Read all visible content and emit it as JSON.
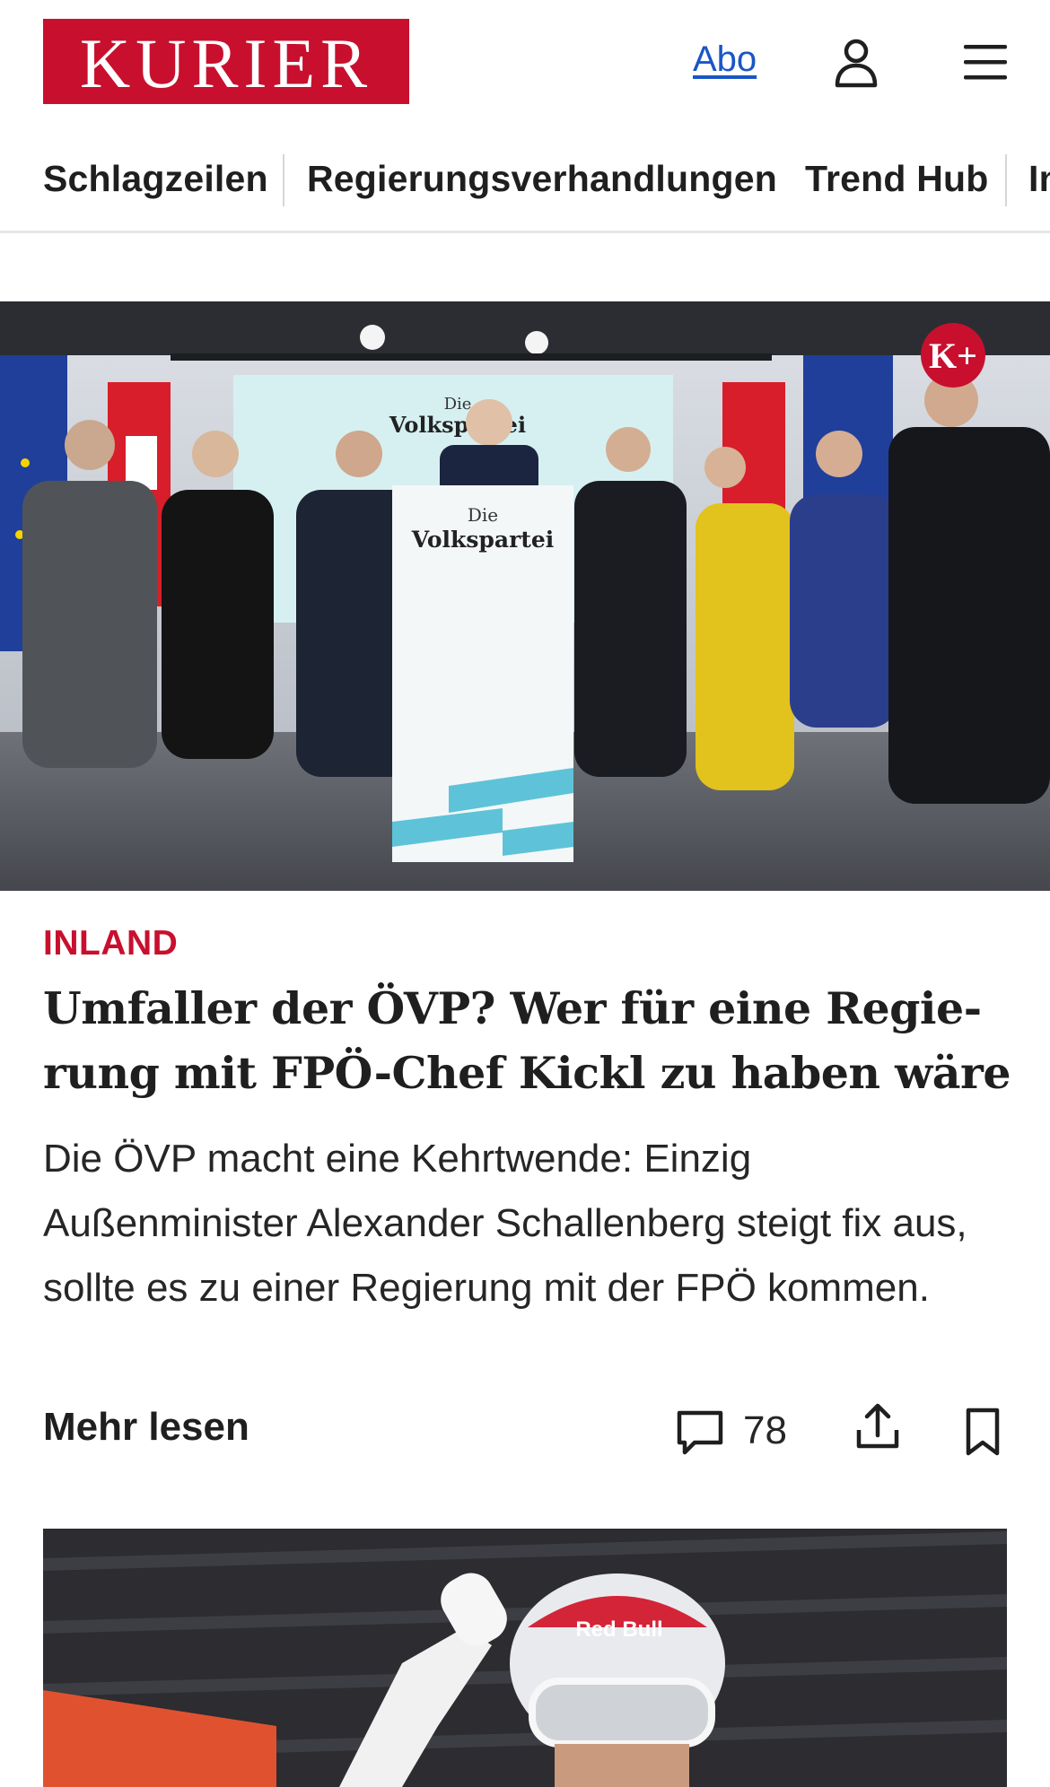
{
  "header": {
    "logo_text": "KURIER",
    "abo_label": "Abo",
    "icons": [
      "user-icon",
      "menu-icon"
    ]
  },
  "nav": {
    "items": [
      {
        "label": "Schlagzeilen"
      },
      {
        "label": "Regierungsverhandlungen"
      },
      {
        "label": "Trend Hub"
      },
      {
        "label": "In"
      }
    ]
  },
  "hero": {
    "podium_text_top": "Die",
    "podium_text_bottom": "Volkspartei",
    "screen_text_top": "Die",
    "screen_text_bottom": "Volkspartei",
    "badge": "K+"
  },
  "article": {
    "category": "INLAND",
    "headline_line1": "Umfaller der ÖVP? Wer für eine Regie-",
    "headline_line2": "rung mit FPÖ-Chef Kickl zu haben wäre",
    "teaser": "Die ÖVP macht eine Kehrtwende: Einzig Außenminister Alexander Schallenberg steigt fix aus, sollte es zu einer Regierung mit der FPÖ kommen.",
    "more_label": "Mehr lesen",
    "comment_count": "78",
    "icons": [
      "comment-icon",
      "share-icon",
      "bookmark-icon"
    ]
  },
  "second_article": {
    "helmet_text": "Red Bull"
  },
  "colors": {
    "brand": "#c8102e",
    "link": "#1a56c4"
  }
}
